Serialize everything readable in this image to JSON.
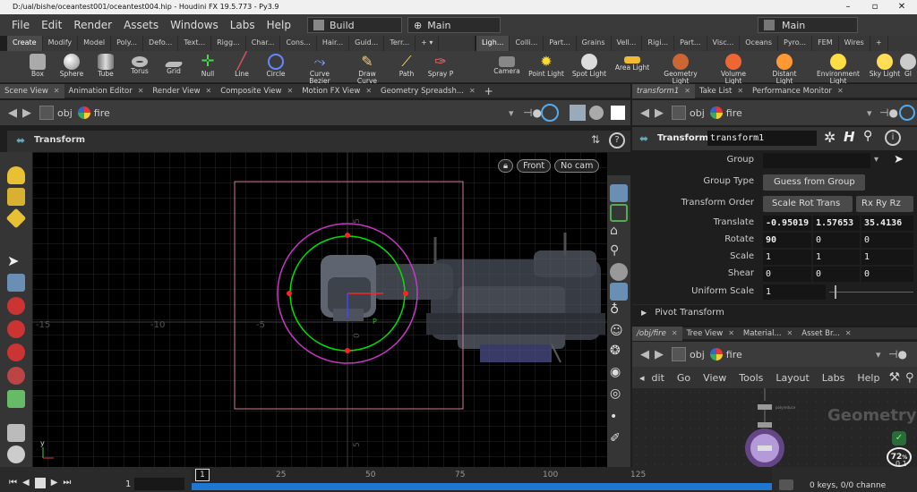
{
  "window": {
    "title": "D:/ual/bishe/oceantest001/oceantest004.hip - Houdini FX 19.5.773 - Py3.9"
  },
  "menu": [
    "File",
    "Edit",
    "Render",
    "Assets",
    "Windows",
    "Labs",
    "Help"
  ],
  "desktops": {
    "build": "Build",
    "main": "Main",
    "main_right": "Main"
  },
  "shelf_tabs_left": [
    "Create",
    "Modify",
    "Model",
    "Poly...",
    "Defo...",
    "Text...",
    "Rigg...",
    "Char...",
    "Cons...",
    "Hair...",
    "Guid...",
    "Terr..."
  ],
  "shelf_tabs_right": [
    "Ligh...",
    "Colli...",
    "Part...",
    "Grains",
    "Vell...",
    "Rigi...",
    "Part...",
    "Visc...",
    "Oceans",
    "Pyro...",
    "FEM",
    "Wires"
  ],
  "tools_left": [
    "Box",
    "Sphere",
    "Tube",
    "Torus",
    "Grid",
    "Null",
    "Line",
    "Circle",
    "Curve Bezier",
    "Draw Curve",
    "Path",
    "Spray P"
  ],
  "tools_right": [
    "Camera",
    "Point Light",
    "Spot Light",
    "Area Light",
    "Geometry Light",
    "Volume Light",
    "Distant Light",
    "Environment Light",
    "Sky Light",
    "GI"
  ],
  "pane_tabs_left": [
    "Scene View",
    "Animation Editor",
    "Render View",
    "Composite View",
    "Motion FX View",
    "Geometry Spreadsh..."
  ],
  "pane_tabs_right_top": [
    "transform1",
    "Take List",
    "Performance Monitor"
  ],
  "pane_tabs_right_bottom": [
    "/obj/fire",
    "Tree View",
    "Material...",
    "Asset Br..."
  ],
  "path": {
    "obj": "obj",
    "node": "fire"
  },
  "viewport": {
    "state": "Transform",
    "view_label": "Front",
    "cam_label": "No cam",
    "axis_labels": [
      "-15",
      "-10",
      "-5",
      "0",
      "5",
      "5"
    ]
  },
  "params": {
    "header": "Transform",
    "node_name": "transform1",
    "group_label": "Group",
    "group_value": "",
    "group_type_label": "Group Type",
    "group_type_value": "Guess from Group",
    "transform_order_label": "Transform Order",
    "transform_order_value": "Scale Rot Trans",
    "rot_order_value": "Rx Ry Rz",
    "translate_label": "Translate",
    "translate": [
      "-0.95019",
      "1.57653",
      "35.4136"
    ],
    "rotate_label": "Rotate",
    "rotate": [
      "90",
      "0",
      "0"
    ],
    "scale_label": "Scale",
    "scale": [
      "1",
      "1",
      "1"
    ],
    "shear_label": "Shear",
    "shear": [
      "0",
      "0",
      "0"
    ],
    "uniform_scale_label": "Uniform Scale",
    "uniform_scale": "1",
    "pivot_label": "Pivot Transform"
  },
  "network": {
    "menu": [
      "dit",
      "Go",
      "View",
      "Tools",
      "Layout",
      "Labs",
      "Help"
    ],
    "watermark": "Geometry",
    "badge": "72",
    "badge_unit": "%",
    "speed": "0.1"
  },
  "timeline": {
    "frame": "1",
    "ticks": [
      "25",
      "50",
      "75",
      "100",
      "125"
    ],
    "start_frame": "1",
    "status": "0 keys, 0/0 channe"
  },
  "colors": {
    "accent": "#1e78d0",
    "node_glow": "#8e5cc7",
    "green_circle": "#00e000",
    "magenta_circle": "#c838c8"
  }
}
